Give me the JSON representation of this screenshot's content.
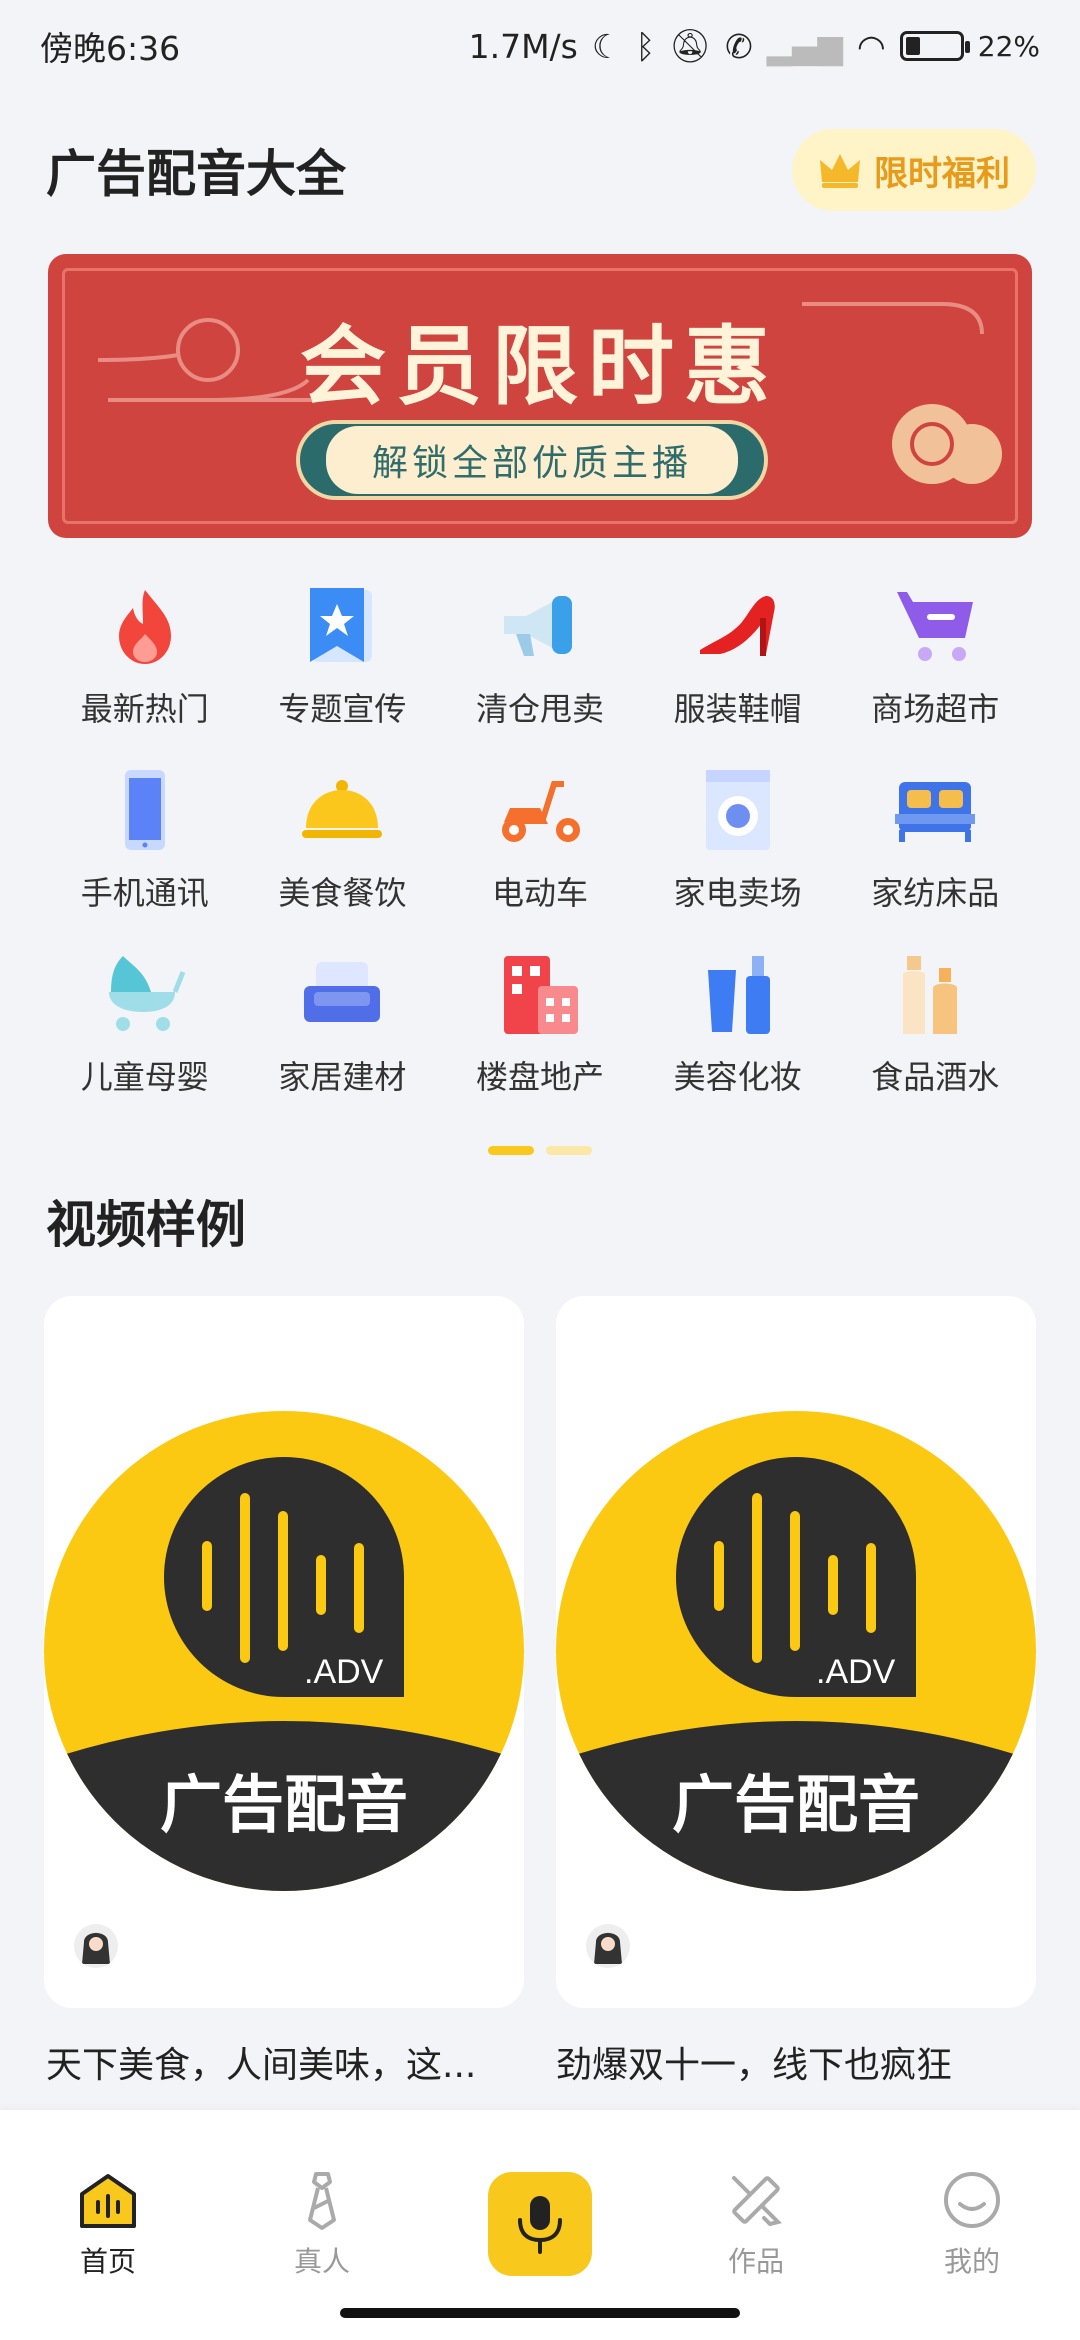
{
  "status": {
    "time": "傍晚6:36",
    "speed": "1.7M/s",
    "battery": "22%"
  },
  "header": {
    "title": "广告配音大全",
    "promo_label": "限时福利"
  },
  "banner": {
    "title": "会员限时惠",
    "subtitle": "解锁全部优质主播"
  },
  "categories": [
    {
      "label": "最新热门",
      "icon": "flame-icon"
    },
    {
      "label": "专题宣传",
      "icon": "star-badge-icon"
    },
    {
      "label": "清仓甩卖",
      "icon": "megaphone-icon"
    },
    {
      "label": "服装鞋帽",
      "icon": "high-heel-icon"
    },
    {
      "label": "商场超市",
      "icon": "shopping-cart-icon"
    },
    {
      "label": "手机通讯",
      "icon": "phone-icon"
    },
    {
      "label": "美食餐饮",
      "icon": "food-cloche-icon"
    },
    {
      "label": "电动车",
      "icon": "scooter-icon"
    },
    {
      "label": "家电卖场",
      "icon": "washing-machine-icon"
    },
    {
      "label": "家纺床品",
      "icon": "bed-icon"
    },
    {
      "label": "儿童母婴",
      "icon": "stroller-icon"
    },
    {
      "label": "家居建材",
      "icon": "sofa-icon"
    },
    {
      "label": "楼盘地产",
      "icon": "building-icon"
    },
    {
      "label": "美容化妆",
      "icon": "cosmetics-icon"
    },
    {
      "label": "食品酒水",
      "icon": "bottles-icon"
    }
  ],
  "section": {
    "title": "视频样例"
  },
  "videos": [
    {
      "caption": "天下美食，人间美味，这...",
      "logo_tag": ".ADV",
      "logo_text": "广告配音"
    },
    {
      "caption": "劲爆双十一，线下也疯狂",
      "logo_tag": ".ADV",
      "logo_text": "广告配音"
    }
  ],
  "tabs": [
    {
      "label": "首页",
      "icon": "home-icon",
      "active": true
    },
    {
      "label": "真人",
      "icon": "person-tie-icon"
    },
    {
      "label": "作品",
      "icon": "pencil-ruler-icon"
    },
    {
      "label": "我的",
      "icon": "smiley-face-icon"
    }
  ],
  "colors": {
    "accent": "#f8c81c",
    "banner_red": "#d0443f",
    "promo_text": "#e89a1a",
    "logo_dark": "#2e2e2e"
  }
}
